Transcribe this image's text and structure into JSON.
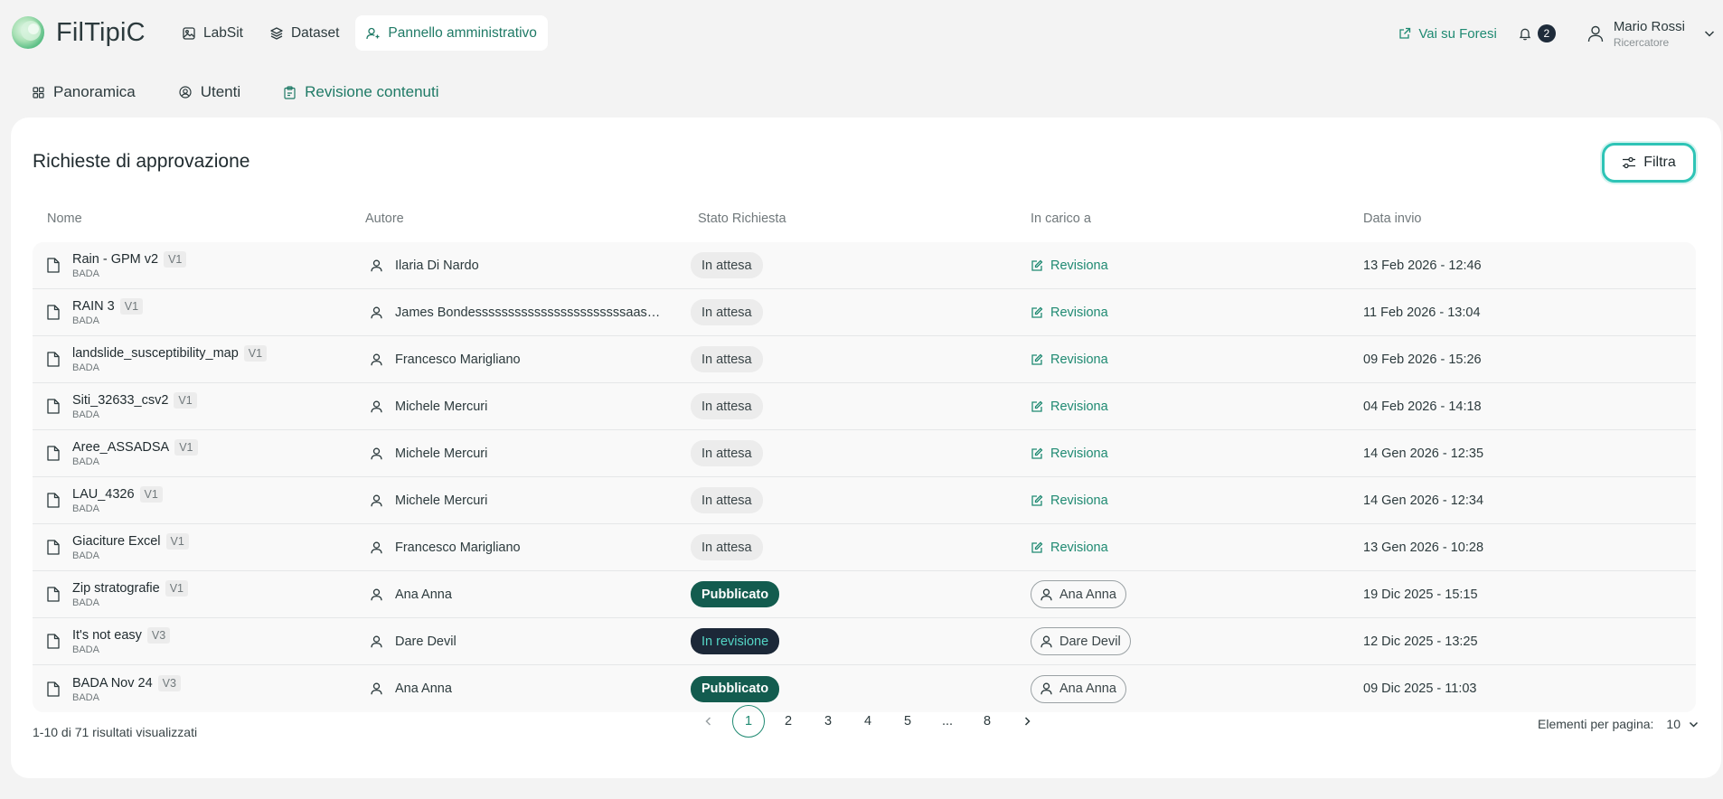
{
  "app": {
    "name": "FilTipiC"
  },
  "nav": [
    {
      "label": "LabSit",
      "icon": "image-icon"
    },
    {
      "label": "Dataset",
      "icon": "layers-icon"
    },
    {
      "label": "Pannello amministrativo",
      "icon": "user-admin-icon",
      "active": true
    }
  ],
  "header": {
    "external_link": "Vai su Foresi",
    "notifications_count": "2",
    "user_name": "Mario Rossi",
    "user_role": "Ricercatore"
  },
  "subtabs": [
    {
      "label": "Panoramica",
      "icon": "grid-icon"
    },
    {
      "label": "Utenti",
      "icon": "user-circle-icon"
    },
    {
      "label": "Revisione contenuti",
      "icon": "clipboard-icon",
      "active": true
    }
  ],
  "main": {
    "title": "Richieste di approvazione",
    "filter_label": "Filtra",
    "columns": [
      "Nome",
      "Autore",
      "Stato Richiesta",
      "In carico a",
      "Data invio"
    ],
    "rows": [
      {
        "name": "Rain - GPM v2",
        "version": "V1",
        "source": "BADA",
        "author": "Ilaria Di Nardo",
        "status": "In attesa",
        "status_type": "attesa",
        "assigned": "Revisiona",
        "assigned_type": "action",
        "date": "13 Feb 2026 - 12:46"
      },
      {
        "name": "RAIN 3",
        "version": "V1",
        "source": "BADA",
        "author": "James Bondesssssssssssssssssssssssaasas...",
        "status": "In attesa",
        "status_type": "attesa",
        "assigned": "Revisiona",
        "assigned_type": "action",
        "date": "11 Feb 2026 - 13:04"
      },
      {
        "name": "landslide_susceptibility_map",
        "version": "V1",
        "source": "BADA",
        "author": "Francesco Marigliano",
        "status": "In attesa",
        "status_type": "attesa",
        "assigned": "Revisiona",
        "assigned_type": "action",
        "date": "09 Feb 2026 - 15:26"
      },
      {
        "name": "Siti_32633_csv2",
        "version": "V1",
        "source": "BADA",
        "author": "Michele Mercuri",
        "status": "In attesa",
        "status_type": "attesa",
        "assigned": "Revisiona",
        "assigned_type": "action",
        "date": "04 Feb 2026 - 14:18"
      },
      {
        "name": "Aree_ASSADSA",
        "version": "V1",
        "source": "BADA",
        "author": "Michele Mercuri",
        "status": "In attesa",
        "status_type": "attesa",
        "assigned": "Revisiona",
        "assigned_type": "action",
        "date": "14 Gen 2026 - 12:35"
      },
      {
        "name": "LAU_4326",
        "version": "V1",
        "source": "BADA",
        "author": "Michele Mercuri",
        "status": "In attesa",
        "status_type": "attesa",
        "assigned": "Revisiona",
        "assigned_type": "action",
        "date": "14 Gen 2026 - 12:34"
      },
      {
        "name": "Giaciture Excel",
        "version": "V1",
        "source": "BADA",
        "author": "Francesco Marigliano",
        "status": "In attesa",
        "status_type": "attesa",
        "assigned": "Revisiona",
        "assigned_type": "action",
        "date": "13 Gen 2026 - 10:28"
      },
      {
        "name": "Zip stratografie",
        "version": "V1",
        "source": "BADA",
        "author": "Ana Anna",
        "status": "Pubblicato",
        "status_type": "pubblicato",
        "assigned": "Ana Anna",
        "assigned_type": "user",
        "date": "19 Dic 2025 - 15:15"
      },
      {
        "name": "It's not easy",
        "version": "V3",
        "source": "BADA",
        "author": "Dare Devil",
        "status": "In revisione",
        "status_type": "revisione",
        "assigned": "Dare Devil",
        "assigned_type": "user",
        "date": "12 Dic 2025 - 13:25"
      },
      {
        "name": "BADA Nov 24",
        "version": "V3",
        "source": "BADA",
        "author": "Ana Anna",
        "status": "Pubblicato",
        "status_type": "pubblicato",
        "assigned": "Ana Anna",
        "assigned_type": "user",
        "date": "09 Dic 2025 - 11:03"
      }
    ]
  },
  "footer": {
    "results_text": "1-10 di 71 risultati visualizzati",
    "pages": [
      "1",
      "2",
      "3",
      "4",
      "5",
      "...",
      "8"
    ],
    "current_page": "1",
    "per_page_label": "Elementi per pagina:",
    "per_page_value": "10"
  },
  "colors": {
    "accent": "#1f8a72",
    "published": "#135c4f",
    "in_review": "#1c2838",
    "filter_border": "#2ec4b6"
  }
}
